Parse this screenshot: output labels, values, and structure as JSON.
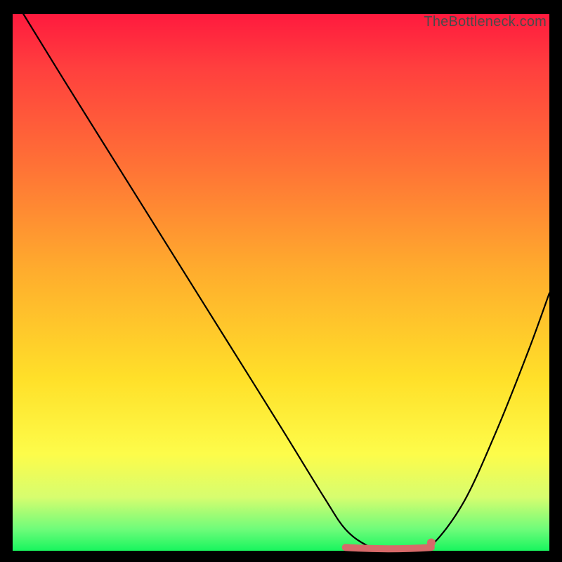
{
  "watermark": "TheBottleneck.com",
  "chart_data": {
    "type": "line",
    "title": "",
    "xlabel": "",
    "ylabel": "",
    "xlim": [
      0,
      100
    ],
    "ylim": [
      0,
      100
    ],
    "grid": false,
    "series": [
      {
        "name": "curve",
        "color": "#000000",
        "x": [
          2,
          10,
          20,
          30,
          40,
          50,
          58,
          62,
          66,
          70,
          74,
          78,
          84,
          90,
          96,
          100
        ],
        "y": [
          100,
          87,
          71,
          55,
          39,
          23,
          10,
          4,
          1,
          0,
          0,
          1,
          9,
          22,
          37,
          48
        ]
      }
    ],
    "flat_segment": {
      "color": "#d76a6a",
      "x_start": 62,
      "x_end": 78,
      "y": 0.5,
      "end_dot_x": 78,
      "end_dot_y": 1.5
    }
  }
}
